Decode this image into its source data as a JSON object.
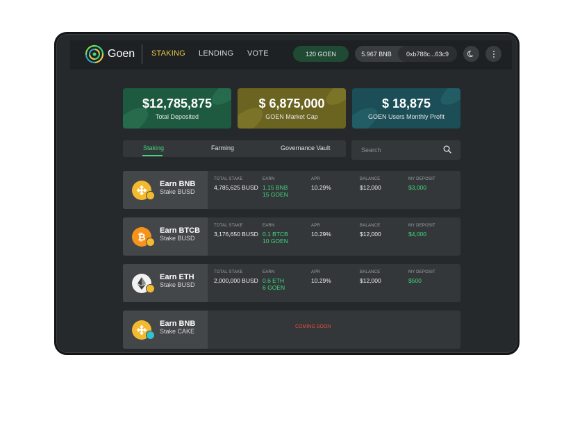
{
  "header": {
    "brand": "Goen",
    "nav": [
      "STAKING",
      "LENDING",
      "VOTE"
    ],
    "goen_balance": "120 GOEN",
    "bnb_balance": "5.967 BNB",
    "address": "0xb788c...63c9",
    "icons": {
      "logo": "goen-logo",
      "theme": "moon-icon",
      "menu": "more-vertical-icon"
    }
  },
  "stats": [
    {
      "value": "$12,785,875",
      "label": "Total Deposited",
      "color": "#1d5a3f"
    },
    {
      "value": "$ 6,875,000",
      "label": "GOEN Market Cap",
      "color": "#6b6420"
    },
    {
      "value": "$ 18,875",
      "label": "GOEN Users Monthly Profit",
      "color": "#1b4e56"
    }
  ],
  "tabs": [
    "Staking",
    "Farming",
    "Governance Vault"
  ],
  "search": {
    "placeholder": "Search"
  },
  "columns": [
    "TOTAL STAKE",
    "EARN",
    "APR",
    "BALANCE",
    "MY DEPOSIT"
  ],
  "pools": [
    {
      "title": "Earn BNB",
      "sub": "Stake BUSD",
      "coin": "bnb",
      "total_stake": "4,785,625 BUSD",
      "earn": [
        "1.15 BNB",
        "15 GOEN"
      ],
      "apr": "10.29%",
      "balance": "$12,000",
      "deposit": "$3,000"
    },
    {
      "title": "Earn BTCB",
      "sub": "Stake BUSD",
      "coin": "btc",
      "total_stake": "3,176,650 BUSD",
      "earn": [
        "0.1 BTCB",
        "10 GOEN"
      ],
      "apr": "10.29%",
      "balance": "$12,000",
      "deposit": "$4,000"
    },
    {
      "title": "Earn ETH",
      "sub": "Stake BUSD",
      "coin": "eth",
      "total_stake": "2,000,000 BUSD",
      "earn": [
        "0.6 ETH",
        "6 GOEN"
      ],
      "apr": "10.29%",
      "balance": "$12,000",
      "deposit": "$500"
    },
    {
      "title": "Earn BNB",
      "sub": "Stake CAKE",
      "coin": "bnb",
      "status": "COMING SOON"
    }
  ]
}
